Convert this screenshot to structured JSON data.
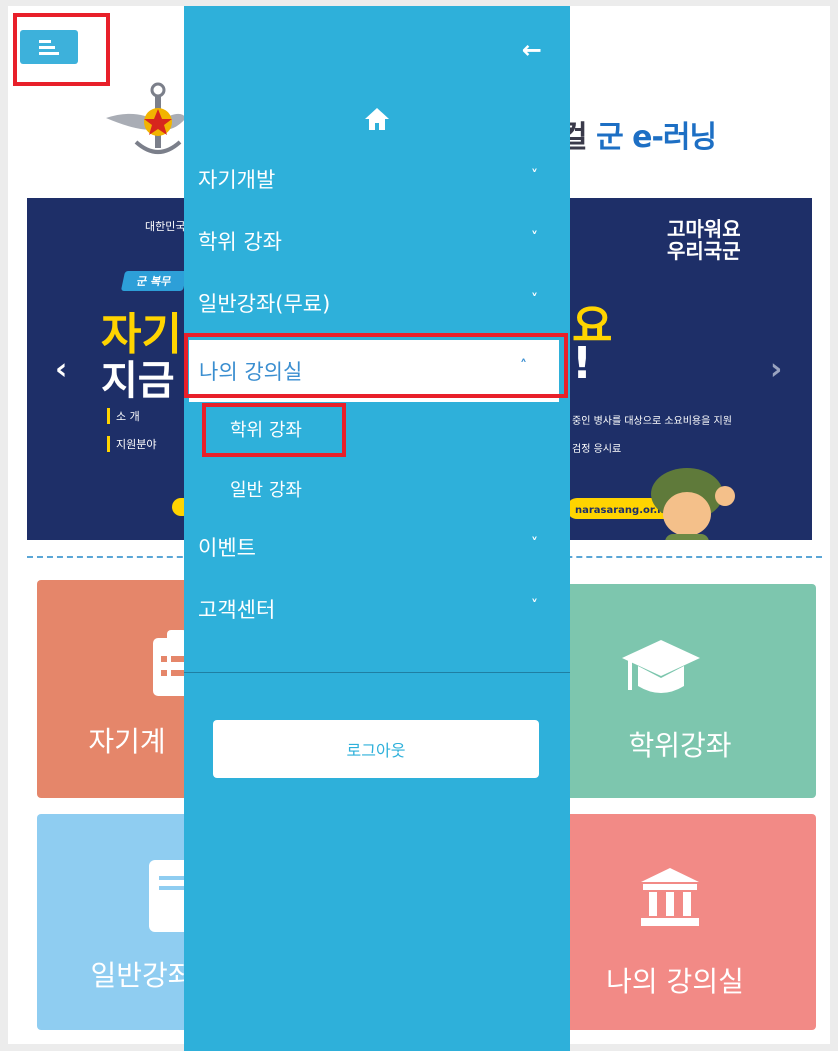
{
  "header": {
    "title_dark": "컬",
    "title_blue": "군 e-러닝"
  },
  "banner": {
    "ministry": "대한민국",
    "badge": "군 복무",
    "big1": "자기",
    "big2": "지금",
    "small1": "소    개",
    "small2": "지원분야",
    "slogan1": "고마워요",
    "slogan2": "우리국군",
    "big_right_yellow": "요",
    "big_right_white": "!",
    "right1": "중인 병사를 대상으로 소요비용을 지원",
    "right2": "검정 응시료",
    "url": "narasarang.or.kr) 참조",
    "prev_arrow": "‹",
    "next_arrow": "›"
  },
  "tiles": {
    "t1": "자기계",
    "t2": "학위강좌",
    "t3": "일반강좌",
    "t4": "나의 강의실"
  },
  "panel": {
    "back": "←",
    "items": [
      {
        "label": "자기개발",
        "chev": "˅"
      },
      {
        "label": "학위 강좌",
        "chev": "˅"
      },
      {
        "label": "일반강좌(무료)",
        "chev": "˅"
      },
      {
        "label": "나의 강의실",
        "chev": "˄"
      },
      {
        "label": "이벤트",
        "chev": "˅"
      },
      {
        "label": "고객센터",
        "chev": "˅"
      }
    ],
    "sub_items": [
      "학위 강좌",
      "일반 강좌"
    ],
    "logout": "로그아웃"
  },
  "colors": {
    "panel_bg": "#2eb0da",
    "highlight": "#e8202a",
    "accent_blue": "#1d6fc4"
  }
}
